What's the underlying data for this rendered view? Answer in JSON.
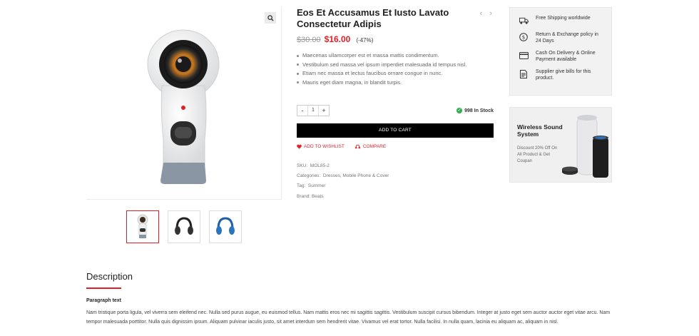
{
  "gallery": {
    "zoom_icon": "search-icon",
    "thumbnails": [
      {
        "name": "camera-thumbnail",
        "active": true
      },
      {
        "name": "black-headphones-thumbnail",
        "active": false
      },
      {
        "name": "blue-headphones-thumbnail",
        "active": false
      }
    ]
  },
  "product": {
    "title": "Eos Et Accusamus Et Iusto Lavato Consectetur Adipis",
    "prev_icon": "chevron-left-icon",
    "next_icon": "chevron-right-icon",
    "old_price": "$30.00",
    "new_price": "$16.00",
    "discount": "(-47%)",
    "features": [
      "Maecenas ullamcorper est et massa mattis condimentum.",
      "Vestibulum sed massa vel ipsum imperdiet malesuada id tempus nisl.",
      "Etiam nec massa et lectus faucibus ornare congue in nunc.",
      "Mauris eget diam magna, in blandit turpis."
    ],
    "qty_minus": "-",
    "qty_value": "1",
    "qty_plus": "+",
    "stock": "998 In Stock",
    "add_to_cart": "ADD TO CART",
    "wishlist": "ADD TO WISHLIST",
    "compare": "COMPARE",
    "sku_label": "SKU:",
    "sku": "MOL85-2",
    "categories_label": "Categories:",
    "categories": "Dresses, Mobile Phone & Cover",
    "tag_label": "Tag:",
    "tag": "Summer",
    "brand_label": "Brand:",
    "brand": "Beats"
  },
  "services": [
    {
      "icon": "truck-icon",
      "text": "Free Shipping worldwide"
    },
    {
      "icon": "dollar-icon",
      "text": "Return & Exchange policy in 24 Days"
    },
    {
      "icon": "credit-card-icon",
      "text": "Cash On Delivery & Online Payment available"
    },
    {
      "icon": "invoice-icon",
      "text": "Supplier give bills for this product."
    }
  ],
  "banner": {
    "heading": "Wireless Sound System",
    "subtext": "Discount 20% Off On All Product & Get Coupan"
  },
  "description": {
    "tab": "Description",
    "paragraph_title": "Paragraph text",
    "paragraph": "Nam tristique porta ligula, vel viverra sem eleifend nec. Nulla sed purus augue, eu euismod tellus. Nam mattis eros nec mi sagittis sagittis. Vestibulum suscipit cursus bibendum. Integer at justo eget sem auctor auctor eget vitae arcu. Nam tempor malesuada porttitor. Nulla quis dignissim ipsum. Aliquam pulvinar iaculis justo, sit amet interdum sem hendrerit vitae. Vivamus vel erat tortor. Nulla facilisi. In nulla quam, lacinia eu aliquam ac, aliquam in nisl."
  },
  "colors": {
    "accent": "#e31e25",
    "stock_green": "#2bb24c",
    "button_black": "#000000"
  }
}
